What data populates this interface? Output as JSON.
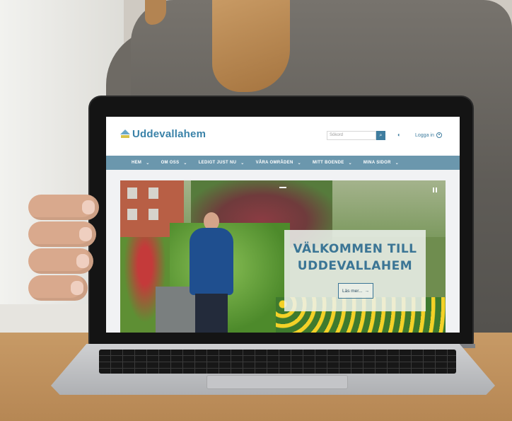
{
  "site": {
    "logo_text": "Uddevallahem",
    "search_placeholder": "Sökord",
    "login_label": "Logga in",
    "nav": [
      {
        "label": "HEM"
      },
      {
        "label": "OM OSS"
      },
      {
        "label": "LEDIGT JUST NU"
      },
      {
        "label": "VÅRA OMRÅDEN"
      },
      {
        "label": "MITT BOENDE"
      },
      {
        "label": "MINA SIDOR"
      }
    ],
    "hero": {
      "title_line1": "VÄLKOMMEN TILL",
      "title_line2": "UDDEVALLAHEM",
      "button_label": "Läs mer...",
      "button_icon": "→"
    }
  },
  "icons": {
    "search": "⌕",
    "moon": "◐",
    "chevron": "⌄"
  },
  "colors": {
    "brand_blue": "#3a82a8",
    "nav_bg": "#6b97ad"
  }
}
